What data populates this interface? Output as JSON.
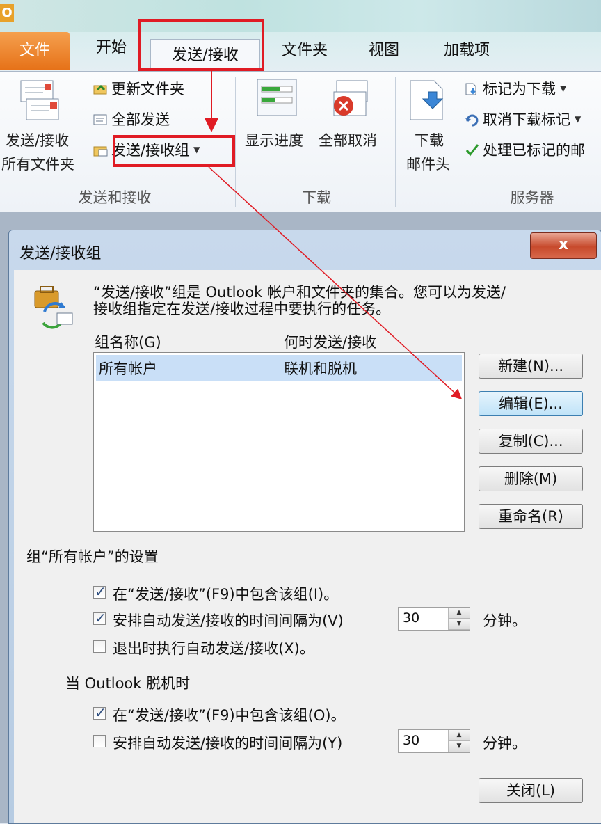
{
  "ribbon": {
    "app_icon": "O",
    "tabs": {
      "file": "文件",
      "home": "开始",
      "send_receive": "发送/接收",
      "folder": "文件夹",
      "view": "视图",
      "addins": "加载项"
    },
    "groups": {
      "send_receive": {
        "label": "发送和接收",
        "big_button": [
          "发送/接收",
          "所有文件夹"
        ],
        "update_folder": "更新文件夹",
        "send_all": "全部发送",
        "send_receive_groups": "发送/接收组"
      },
      "download": {
        "label": "下载",
        "show_progress": "显示进度",
        "cancel_all": "全部取消"
      },
      "server": {
        "label": "服务器",
        "download_headers": [
          "下载",
          "邮件头"
        ],
        "mark_to_download": "标记为下载",
        "unmark_download": "取消下载标记",
        "process_marked": "处理已标记的邮"
      }
    }
  },
  "dialog": {
    "title": "发送/接收组",
    "close_symbol": "x",
    "description_line1": "“发送/接收”组是 Outlook 帐户和文件夹的集合。您可以为发送/",
    "description_line2": "接收组指定在发送/接收过程中要执行的任务。",
    "list": {
      "col_name": "组名称(G)",
      "col_when": "何时发送/接收",
      "rows": [
        {
          "name": "所有帐户",
          "when": "联机和脱机"
        }
      ]
    },
    "buttons": {
      "new": "新建(N)...",
      "edit": "编辑(E)...",
      "copy": "复制(C)...",
      "delete": "删除(M)",
      "rename": "重命名(R)",
      "close": "关闭(L)"
    },
    "settings_header": "组“所有帐户”的设置",
    "online": {
      "include_group": {
        "label": "在“发送/接收”(F9)中包含该组(I)。",
        "checked": true
      },
      "schedule": {
        "label": "安排自动发送/接收的时间间隔为(V)",
        "checked": true,
        "value": "30",
        "unit": "分钟。"
      },
      "on_exit": {
        "label": "退出时执行自动发送/接收(X)。",
        "checked": false
      }
    },
    "offline_header": "当 Outlook 脱机时",
    "offline": {
      "include_group": {
        "label": "在“发送/接收”(F9)中包含该组(O)。",
        "checked": true
      },
      "schedule": {
        "label": "安排自动发送/接收的时间间隔为(Y)",
        "checked": false,
        "value": "30",
        "unit": "分钟。"
      }
    }
  },
  "colors": {
    "highlight_red": "#e01b24",
    "file_tab_orange": "#e67219",
    "selection_blue": "#c9dff7"
  }
}
